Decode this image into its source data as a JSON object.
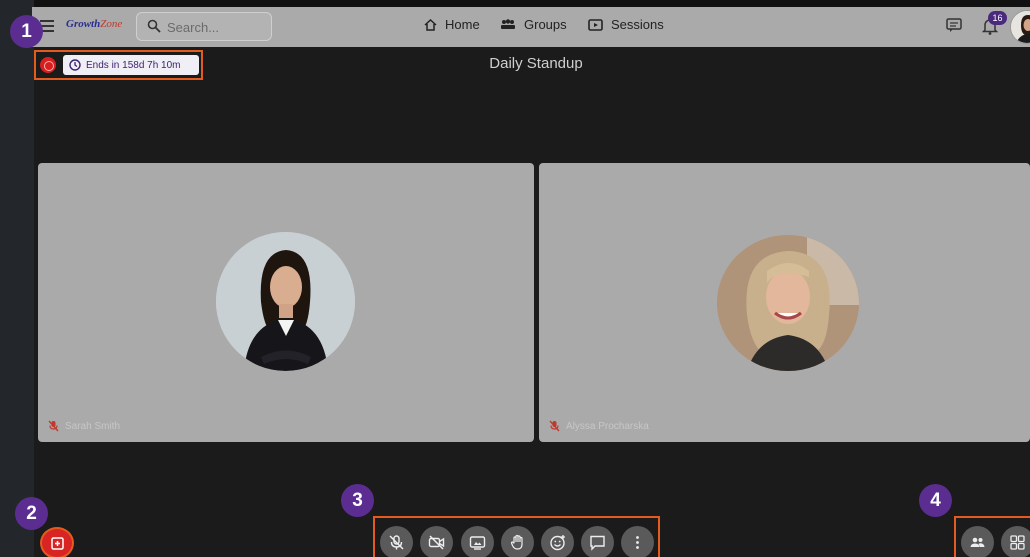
{
  "nav": {
    "logo_main": "Growth",
    "logo_accent": "Zone",
    "search_placeholder": "Search...",
    "links": [
      "Home",
      "Groups",
      "Sessions"
    ],
    "notification_count": "16"
  },
  "callouts": [
    "1",
    "2",
    "3",
    "4"
  ],
  "session": {
    "title": "Daily Standup",
    "timer": "Ends in 158d 7h 10m"
  },
  "participants": [
    {
      "name": "Sarah Smith",
      "muted": true
    },
    {
      "name": "Alyssa Procharska",
      "muted": true
    }
  ],
  "controls": [
    "mic-off",
    "camera-off",
    "screen-share",
    "raise-hand",
    "reactions",
    "chat",
    "more"
  ],
  "right_controls": [
    "participants",
    "layout"
  ],
  "colors": {
    "callout": "#5b2d91",
    "highlight": "#e35b1f",
    "record": "#d71f1f"
  }
}
